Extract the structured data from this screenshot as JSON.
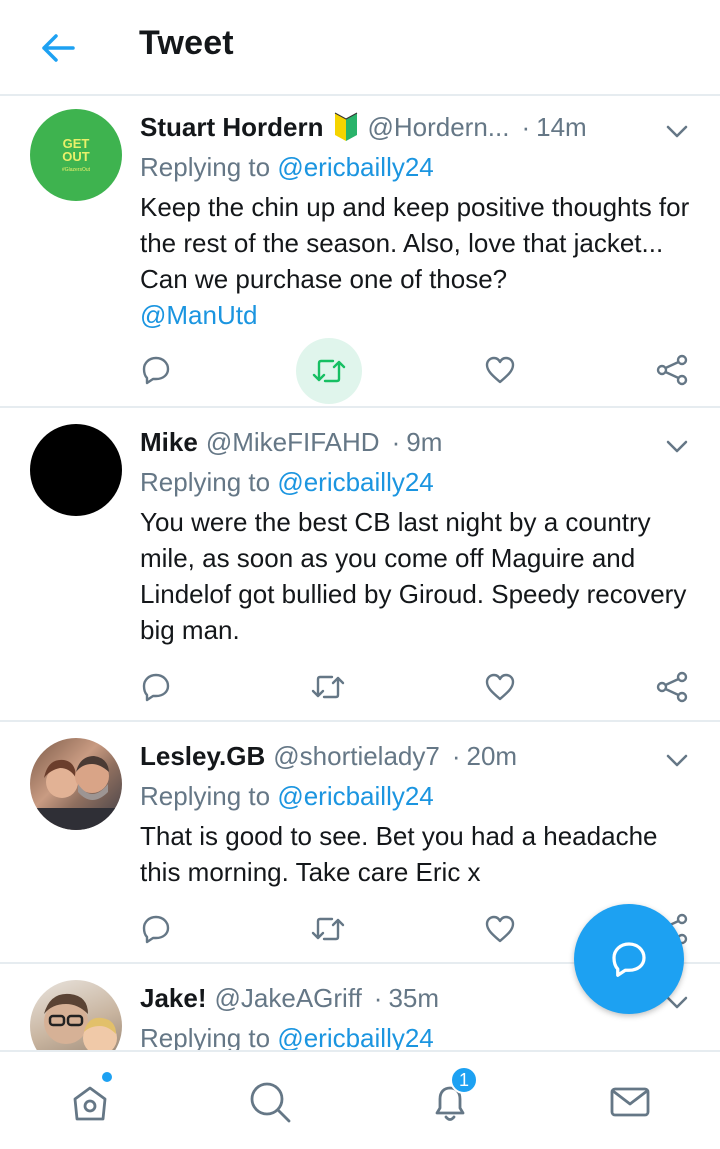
{
  "header": {
    "title": "Tweet",
    "back_icon": "arrow-left-icon"
  },
  "colors": {
    "accent": "#1da1f2",
    "muted": "#657786",
    "retweet_active": "#17bf63"
  },
  "tweets": [
    {
      "name": "Stuart Hordern",
      "handle": "@Hordern...",
      "time": "14m",
      "replying_prefix": "Replying to ",
      "replying_to": "@ericbailly24",
      "text": "Keep the chin up and keep positive thoughts for the rest of the season. Also, love that jacket... Can we purchase one of those?",
      "mention": "@ManUtd",
      "retweet_active": true,
      "avatar_lines": [
        "GET",
        "OUT",
        "#GlazersOut"
      ]
    },
    {
      "name": "Mike",
      "handle": "@MikeFIFAHD",
      "time": "9m",
      "replying_prefix": "Replying to ",
      "replying_to": "@ericbailly24",
      "text": "You were the best CB last night by a country mile, as soon as you come off Maguire and Lindelof got bullied by Giroud. Speedy recovery big man."
    },
    {
      "name": "Lesley.GB",
      "handle": "@shortielady7",
      "time": "20m",
      "replying_prefix": "Replying to ",
      "replying_to": "@ericbailly24",
      "text": "That is good to see. Bet you had a headache this morning. Take care Eric x"
    },
    {
      "name": "Jake!",
      "handle": "@JakeAGriff",
      "time": "35m",
      "replying_prefix": "Replying to ",
      "replying_to": "@ericbailly24"
    }
  ],
  "time_separator": "·",
  "bottom_nav": {
    "items": [
      "home-icon",
      "search-icon",
      "notifications-icon",
      "messages-icon"
    ],
    "notifications_badge": "1"
  },
  "fab_icon": "compose-reply-icon"
}
